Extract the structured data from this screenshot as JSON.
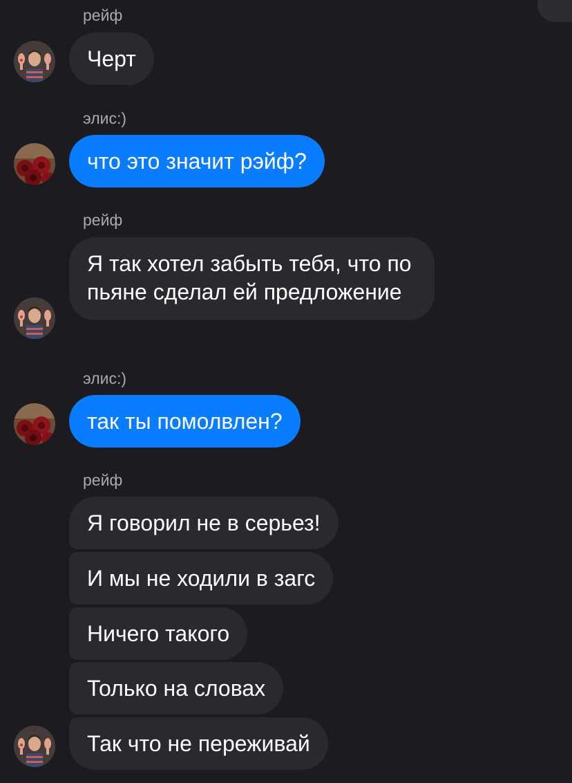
{
  "conversation": {
    "messages": [
      {
        "sender": "рейф",
        "text": "Черт",
        "direction": "incoming"
      },
      {
        "sender": "элис:)",
        "text": "что это значит рэйф?",
        "direction": "outgoing"
      },
      {
        "sender": "рейф",
        "text": "Я так хотел забыть тебя, что по пьяне сделал ей предложение",
        "direction": "incoming"
      },
      {
        "sender": "элис:)",
        "text": "так ты помолвлен?",
        "direction": "outgoing"
      },
      {
        "sender": "рейф",
        "direction": "incoming",
        "group": [
          "Я говорил не в серьез!",
          "И мы не ходили в загс",
          "Ничего такого",
          "Только на словах",
          "Так что не переживай"
        ]
      }
    ]
  },
  "colors": {
    "background": "#1c1b1f",
    "incoming_bubble": "#2a292e",
    "outgoing_bubble": "#0a7cff",
    "sender_name": "#a9a9ae",
    "message_text": "#ffffff"
  },
  "avatars": {
    "rafe": "person-with-raised-hands-avatar",
    "alice": "red-roses-avatar"
  }
}
